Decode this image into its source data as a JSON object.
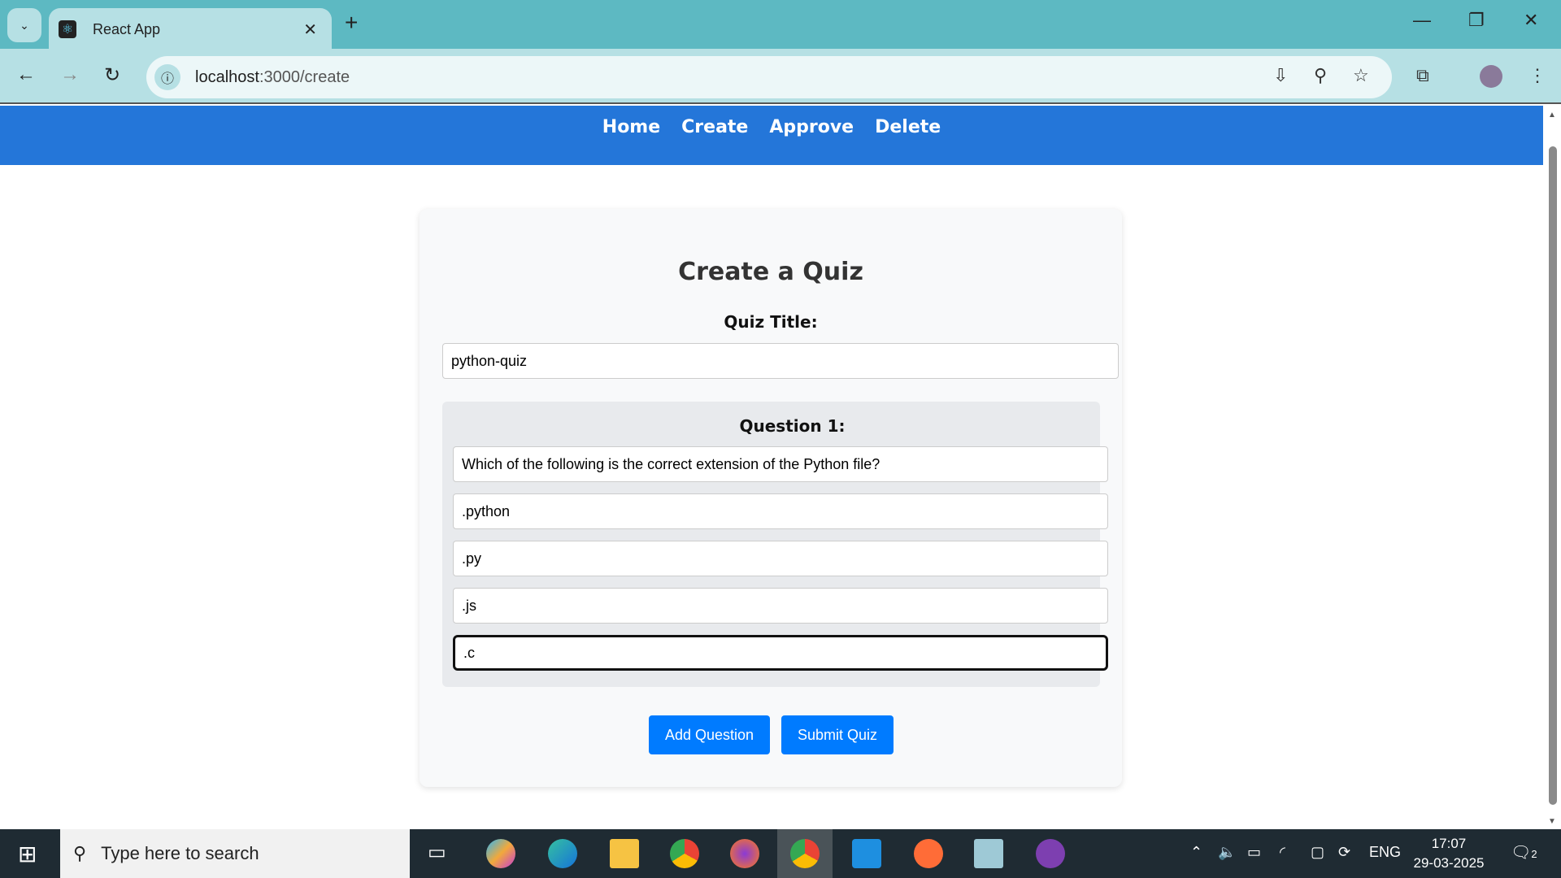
{
  "browser": {
    "tab_title": "React App",
    "url_host": "localhost",
    "url_path": ":3000/create"
  },
  "nav": {
    "links": [
      "Home",
      "Create",
      "Approve",
      "Delete"
    ]
  },
  "form": {
    "heading": "Create a Quiz",
    "quiz_title_label": "Quiz Title:",
    "quiz_title_value": "python-quiz",
    "questions": [
      {
        "label": "Question 1:",
        "text": "Which of the following is the correct extension of the Python file?",
        "options": [
          ".python",
          ".py",
          ".js",
          ".c"
        ]
      }
    ],
    "add_question_label": "Add Question",
    "submit_label": "Submit Quiz"
  },
  "taskbar": {
    "search_placeholder": "Type here to search",
    "language": "ENG",
    "time": "17:07",
    "date": "29-03-2025",
    "notification_count": "2"
  },
  "colors": {
    "nav": "#2476d9",
    "button": "#007bff",
    "tabbar": "#5db9c2"
  }
}
